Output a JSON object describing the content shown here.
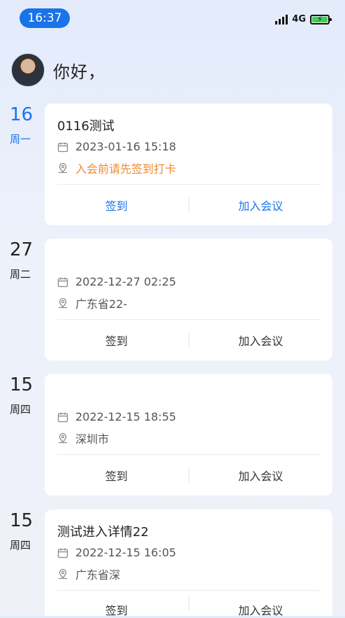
{
  "status_bar": {
    "time": "16:37",
    "network": "4G"
  },
  "greeting": {
    "text": "你好，"
  },
  "entries": [
    {
      "day": "16",
      "weekday": "周一",
      "title": "0116测试",
      "datetime": "2023-01-16 15:18",
      "location": "入会前请先签到打卡",
      "location_is_warning": true,
      "checkin_label": "签到",
      "join_label": "加入会议",
      "active": true
    },
    {
      "day": "27",
      "weekday": "周二",
      "title": "",
      "datetime": "2022-12-27 02:25",
      "location": "广东省22-",
      "checkin_label": "签到",
      "join_label": "加入会议",
      "active": false
    },
    {
      "day": "15",
      "weekday": "周四",
      "title": "",
      "datetime": "2022-12-15 18:55",
      "location": "深圳市",
      "checkin_label": "签到",
      "join_label": "加入会议",
      "active": false
    },
    {
      "day": "15",
      "weekday": "周四",
      "title": "测试进入详情22",
      "datetime": "2022-12-15 16:05",
      "location": "广东省深",
      "checkin_label": "签到",
      "join_label": "加入会议",
      "active": false
    }
  ],
  "colors": {
    "accent": "#1a73e8",
    "warning": "#f08a2a",
    "battery": "#3cd34a"
  },
  "icons": {
    "date": "calendar-icon",
    "location": "map-pin-icon"
  }
}
